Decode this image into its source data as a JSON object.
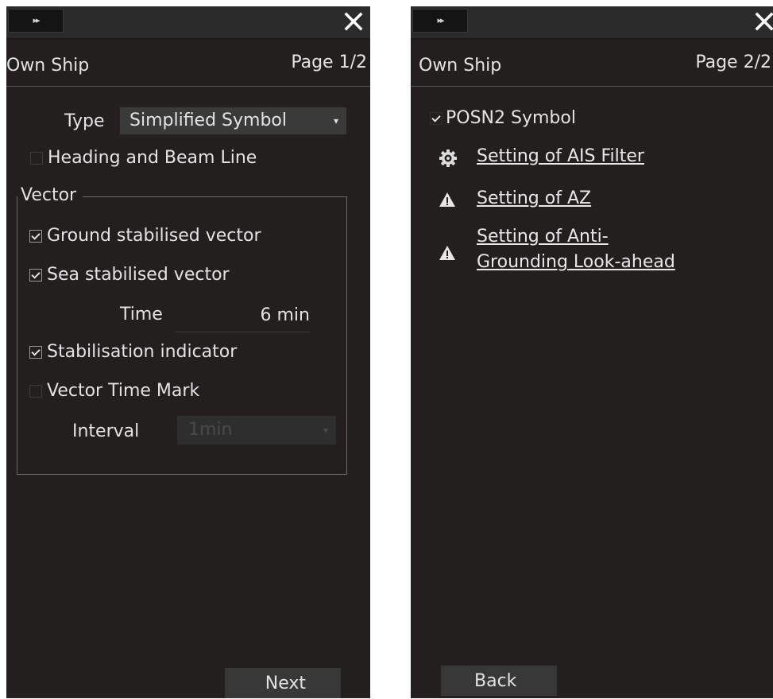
{
  "page1": {
    "expand_glyph": "▸▸",
    "window_title": "Own Ship",
    "page_indicator": "Page 1/2",
    "type": {
      "label": "Type",
      "value": "Simplified Symbol"
    },
    "heading_beam_line": {
      "label": "Heading and Beam Line",
      "checked": false
    },
    "vector_group": {
      "legend": "Vector",
      "ground_stabilised": {
        "label": "Ground stabilised vector",
        "checked": true
      },
      "sea_stabilised": {
        "label": "Sea stabilised vector",
        "checked": true
      },
      "time": {
        "label": "Time",
        "value": "6 min"
      },
      "stabilisation_indicator": {
        "label": "Stabilisation indicator",
        "checked": true
      },
      "vector_time_mark": {
        "label": "Vector Time Mark",
        "checked": false
      },
      "interval": {
        "label": "Interval",
        "value": "1min"
      }
    },
    "next_label": "Next"
  },
  "page2": {
    "expand_glyph": "▸▸",
    "window_title": "Own Ship",
    "page_indicator": "Page 2/2",
    "posn2_symbol": {
      "label": "POSN2 Symbol",
      "checked": true
    },
    "links": {
      "ais_filter": "Setting of AIS Filter",
      "az": "Setting of AZ",
      "anti_grounding_line1": "Setting of Anti-",
      "anti_grounding_line2": "Grounding Look-ahead"
    },
    "back_label": "Back"
  },
  "icons": {
    "close": "close-icon",
    "expand": "double-chevron-right-icon",
    "gear": "gear-icon",
    "warning": "warning-icon",
    "dropdown": "chevron-down-icon"
  }
}
